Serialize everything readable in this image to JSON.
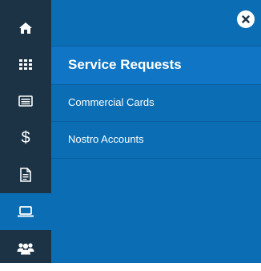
{
  "colors": {
    "rail_bg": "#1b3344",
    "panel_bg": "#0b6eb5",
    "title_bg": "#1075c4",
    "active_item_bg": "#0b6eb5",
    "icon": "#ffffff"
  },
  "rail": {
    "items": [
      {
        "icon": "home-icon"
      },
      {
        "icon": "grid-icon"
      },
      {
        "icon": "list-card-icon"
      },
      {
        "icon": "dollar-icon",
        "label": "$"
      },
      {
        "icon": "document-icon"
      },
      {
        "icon": "laptop-icon",
        "active": true
      },
      {
        "icon": "users-icon"
      }
    ]
  },
  "panel": {
    "close_icon": "close-circle-icon",
    "title": "Service Requests",
    "items": [
      {
        "label": "Commercial Cards"
      },
      {
        "label": "Nostro Accounts"
      }
    ]
  }
}
